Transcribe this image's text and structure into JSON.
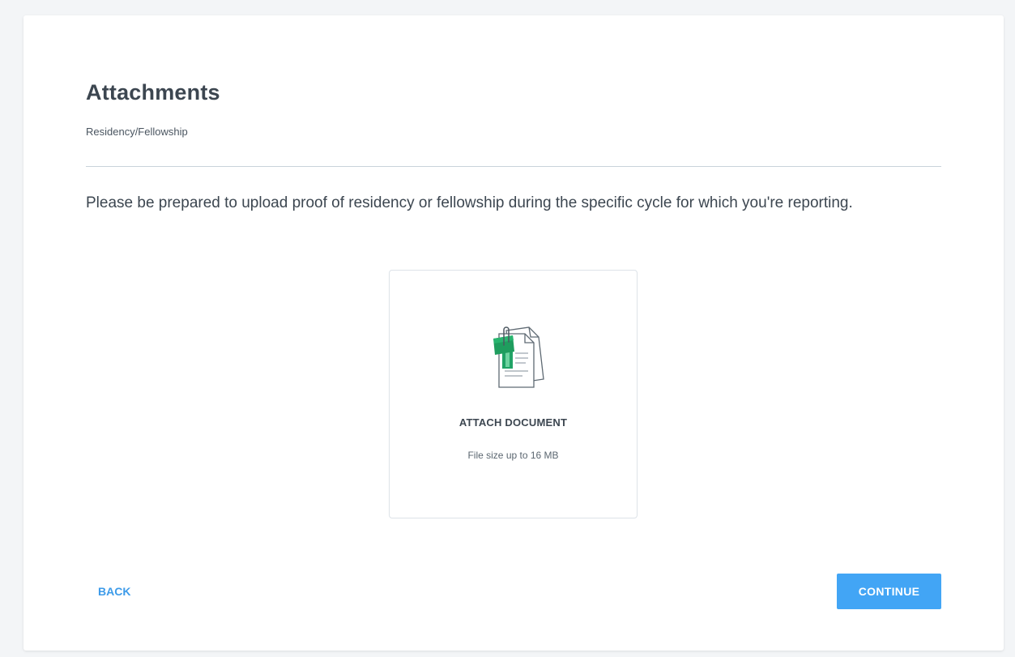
{
  "page": {
    "title": "Attachments",
    "subtitle": "Residency/Fellowship",
    "instructions": "Please be prepared to upload proof of residency or fellowship during the specific cycle for which you're reporting."
  },
  "upload": {
    "icon": "document-with-paperclip-icon",
    "label": "ATTACH DOCUMENT",
    "size_note": "File size up to 16 MB"
  },
  "footer": {
    "back_label": "BACK",
    "continue_label": "CONTINUE"
  },
  "colors": {
    "accent": "#42a5f5",
    "link": "#3d9be9",
    "icon_green": "#21a366",
    "background": "#f3f5f7"
  }
}
